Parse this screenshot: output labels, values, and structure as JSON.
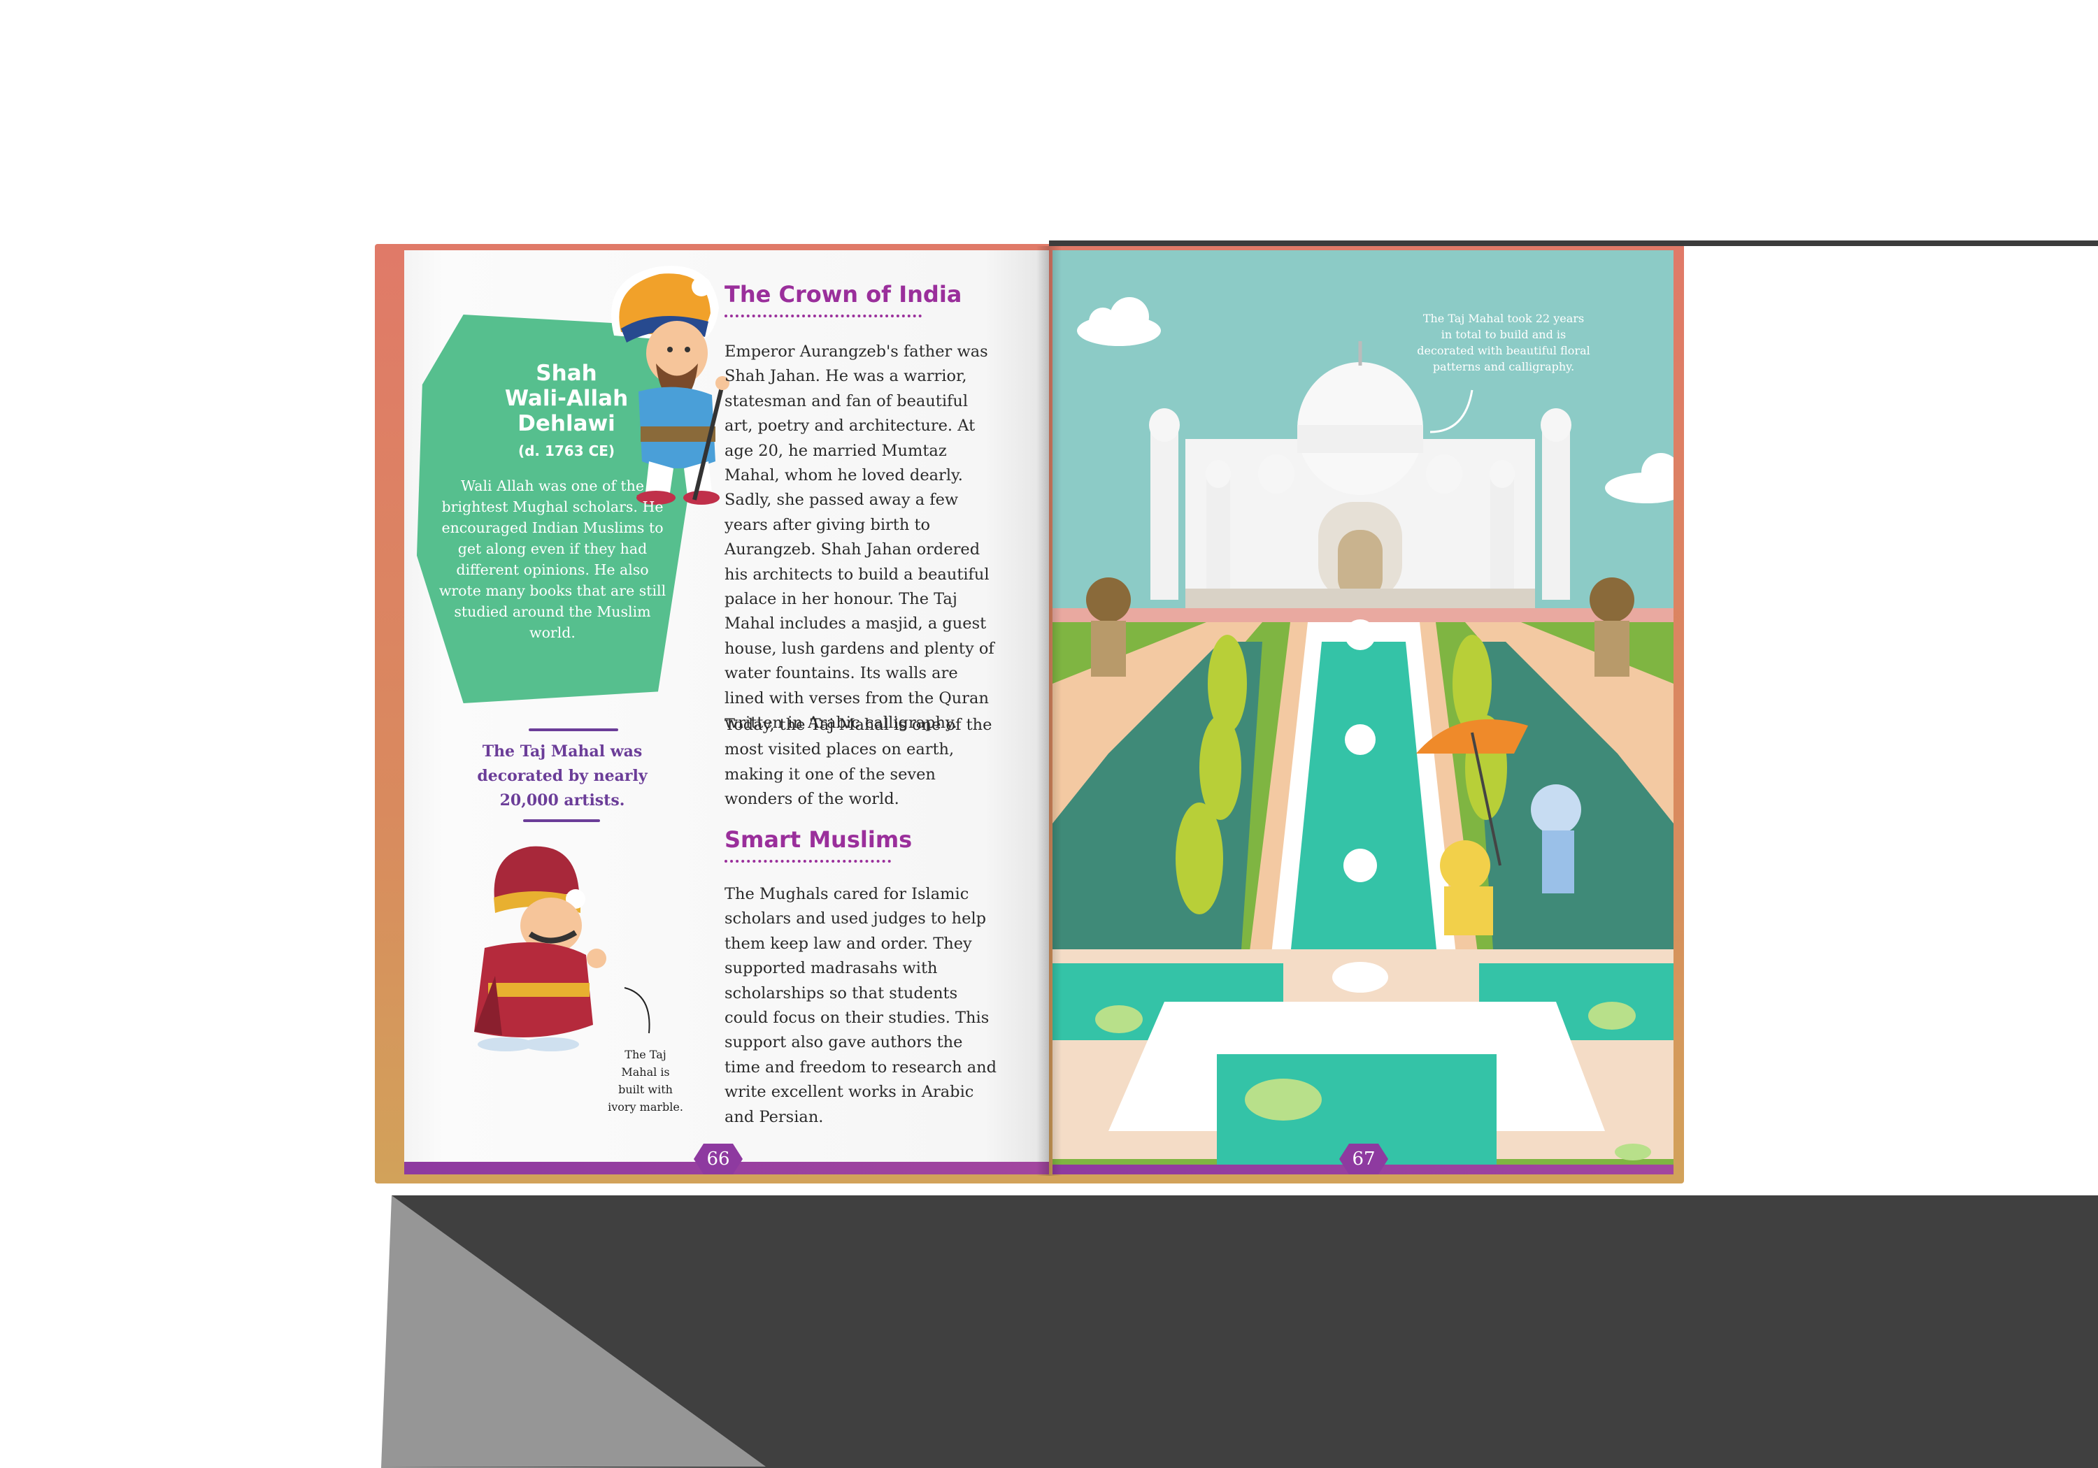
{
  "left_page": {
    "profile": {
      "name_lines": [
        "Shah",
        "Wali-Allah",
        "Dehlawi"
      ],
      "dates": "(d. 1763 CE)",
      "bio": "Wali Allah was one of the brightest Mughal scholars. He encouraged Indian Muslims to get along even if they had different opinions. He also wrote many books that are still studied around the Muslim world."
    },
    "fact": "The Taj Mahal was decorated by nearly 20,000 artists.",
    "character_caption": "The Taj Mahal is built with ivory marble.",
    "section1": {
      "heading": "The Crown of India",
      "para1": "Emperor Aurangzeb's father was Shah Jahan. He was a warrior, statesman and fan of beautiful art, poetry and architecture. At age 20, he married Mumtaz Mahal, whom he loved dearly. Sadly, she passed away a few years after giving birth to Aurangzeb. Shah Jahan ordered his architects to build a beautiful palace in her honour. The Taj Mahal includes a masjid, a guest house, lush gardens and plenty of water fountains. Its walls are lined with verses from the Quran written in Arabic calligraphy.",
      "para2": "Today, the Taj Mahal is one of the most visited places on earth, making it one of the seven wonders of the world."
    },
    "section2": {
      "heading": "Smart Muslims",
      "para": "The Mughals cared for Islamic scholars and used judges to help them keep law and order. They supported madrasahs with scholarships so that students could focus on their studies. This support also gave authors the time and freedom to research and write excellent works in Arabic and Persian."
    },
    "page_number": "66"
  },
  "right_page": {
    "note": "The Taj Mahal took 22 years in total to build and is decorated with beautiful floral patterns and calligraphy.",
    "page_number": "67",
    "illustration": "taj-mahal-garden-illustration"
  },
  "colors": {
    "accent_purple": "#9a2f9b",
    "fact_purple": "#6b3d98",
    "panel_green": "#56bf8e",
    "sky": "#8ccbc6",
    "grass": "#7fb542",
    "water": "#34c3a7",
    "cover": "#e07a68",
    "shadow": "#404040"
  }
}
